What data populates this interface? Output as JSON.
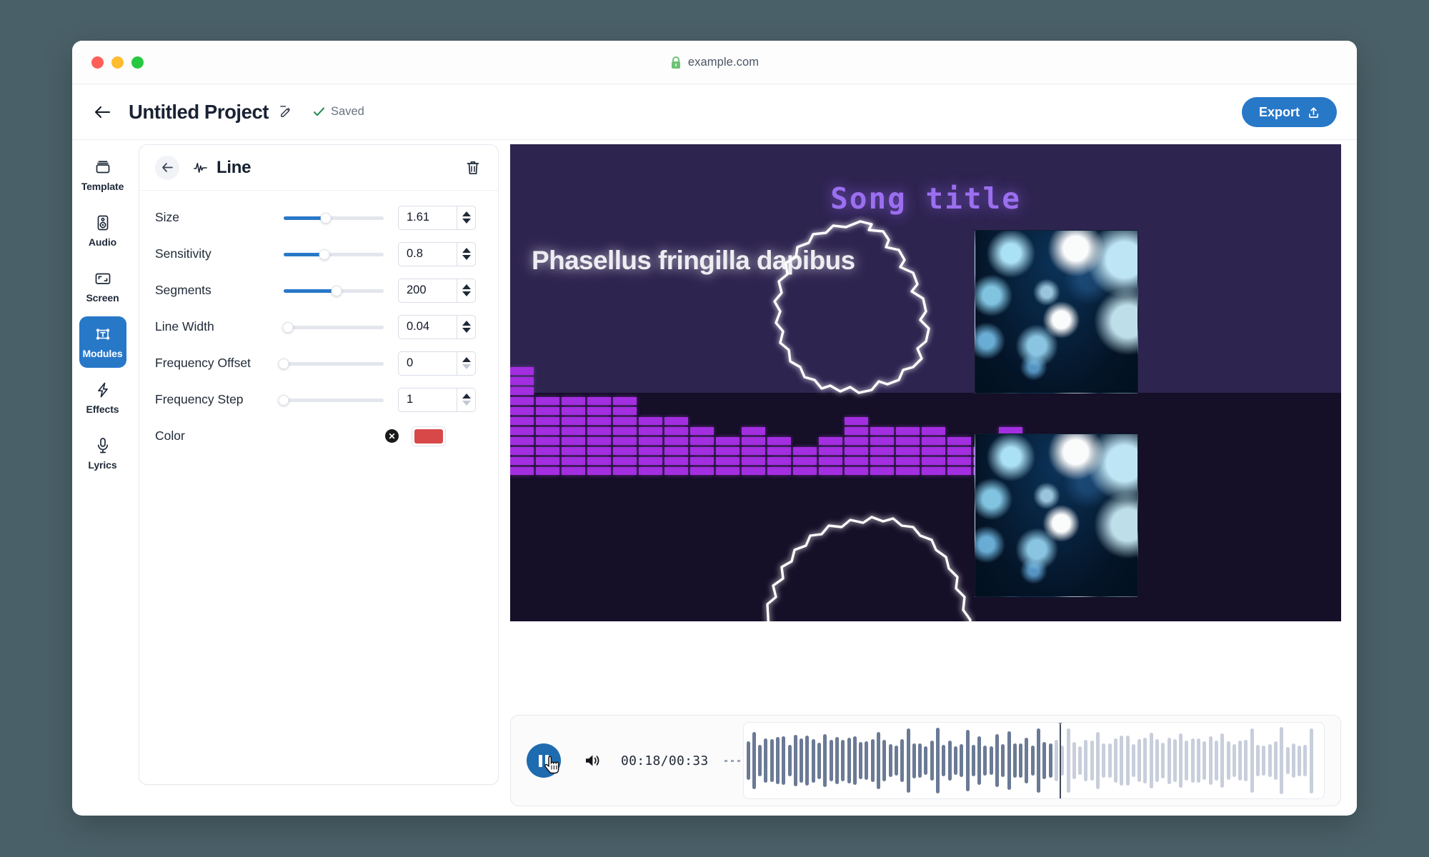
{
  "browser": {
    "url": "example.com",
    "lock_icon": "lock-icon",
    "traffic_lights": [
      "close-red",
      "minimize-yellow",
      "maximize-green"
    ]
  },
  "header": {
    "back_icon": "arrow-left-icon",
    "project_title": "Untitled Project",
    "edit_icon": "pencil-edit-icon",
    "check_icon": "check-icon",
    "saved_label": "Saved",
    "export_label": "Export",
    "export_icon": "upload-share-icon",
    "export_color": "#2878c8"
  },
  "sidebar": {
    "items": [
      {
        "label": "Template",
        "icon": "template-stack-icon",
        "active": false
      },
      {
        "label": "Audio",
        "icon": "speaker-box-icon",
        "active": false
      },
      {
        "label": "Screen",
        "icon": "screen-frame-icon",
        "active": false
      },
      {
        "label": "Modules",
        "icon": "modules-text-icon",
        "active": true
      },
      {
        "label": "Effects",
        "icon": "lightning-bolt-icon",
        "active": false
      },
      {
        "label": "Lyrics",
        "icon": "microphone-icon",
        "active": false
      }
    ],
    "active_color": "#2878c8"
  },
  "panel": {
    "back_icon": "arrow-left-icon",
    "module_icon": "waveform-line-icon",
    "title": "Line",
    "delete_icon": "trash-icon",
    "properties": [
      {
        "label": "Size",
        "value": "1.61",
        "slider_pct": 42,
        "spinner_down_enabled": true
      },
      {
        "label": "Sensitivity",
        "value": "0.8",
        "slider_pct": 41,
        "spinner_down_enabled": true
      },
      {
        "label": "Segments",
        "value": "200",
        "slider_pct": 53,
        "spinner_down_enabled": true
      },
      {
        "label": "Line Width",
        "value": "0.04",
        "slider_pct": 4,
        "spinner_down_enabled": true
      },
      {
        "label": "Frequency Offset",
        "value": "0",
        "slider_pct": 0,
        "spinner_down_enabled": false
      },
      {
        "label": "Frequency Step",
        "value": "1",
        "slider_pct": 0,
        "spinner_down_enabled": false
      }
    ],
    "color_row": {
      "label": "Color",
      "clear_icon": "clear-circle-x-icon",
      "swatch": "#d94848"
    }
  },
  "preview": {
    "song_title": "Song title",
    "lyric_line": "Phasellus fringilla dapibus",
    "background_top": "#2e2450",
    "background_bottom": "#150f28",
    "spectrum_color": "#a32fe0",
    "line_color": "#ffffff",
    "spectrum_levels": [
      11,
      8,
      8,
      8,
      8,
      6,
      6,
      5,
      4,
      5,
      4,
      3,
      4,
      6,
      5,
      5,
      5,
      4,
      3,
      5,
      4,
      3
    ]
  },
  "player": {
    "play_state": "pause",
    "play_icon": "pause-icon",
    "cursor_icon": "pointer-hand-icon",
    "volume_icon": "volume-on-icon",
    "time_display": "00:18/00:33",
    "current_time": "00:18",
    "total_time": "00:33",
    "progress_pct": 54.5,
    "waveform_played_color": "#6b7a95",
    "waveform_unplayed_color": "#c8cedb"
  }
}
